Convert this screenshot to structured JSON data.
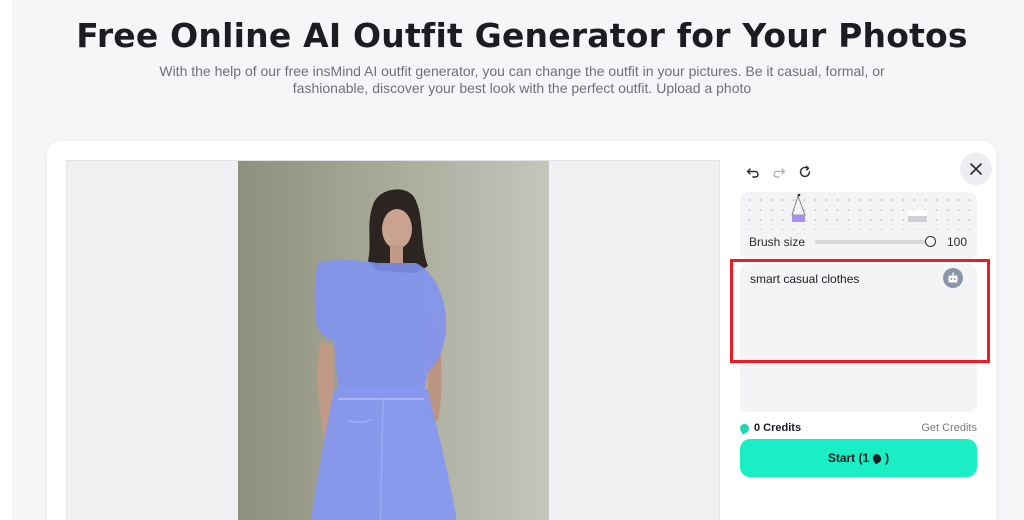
{
  "hero": {
    "title": "Free Online AI Outfit Generator for Your Photos",
    "subtitle": "With the help of our free insMind AI outfit generator, you can change the outfit in your pictures. Be it casual, formal, or fashionable, discover your best look with the perfect outfit. Upload a photo"
  },
  "toolbar": {
    "undo_icon": "undo-icon",
    "redo_icon": "redo-icon",
    "reset_icon": "reset-icon",
    "redo_disabled": true
  },
  "brush": {
    "label": "Brush size",
    "value": "100",
    "level": 1.0
  },
  "prompt": {
    "text": "smart casual clothes",
    "icon": "ai-robot-icon"
  },
  "credits": {
    "amount_label": "0 Credits",
    "get_label": "Get Credits"
  },
  "start": {
    "label_prefix": "Start (1",
    "label_suffix": ")"
  },
  "colors": {
    "accent": "#19eec4",
    "mask": "#7f93f2",
    "highlight": "#ec1d24"
  }
}
